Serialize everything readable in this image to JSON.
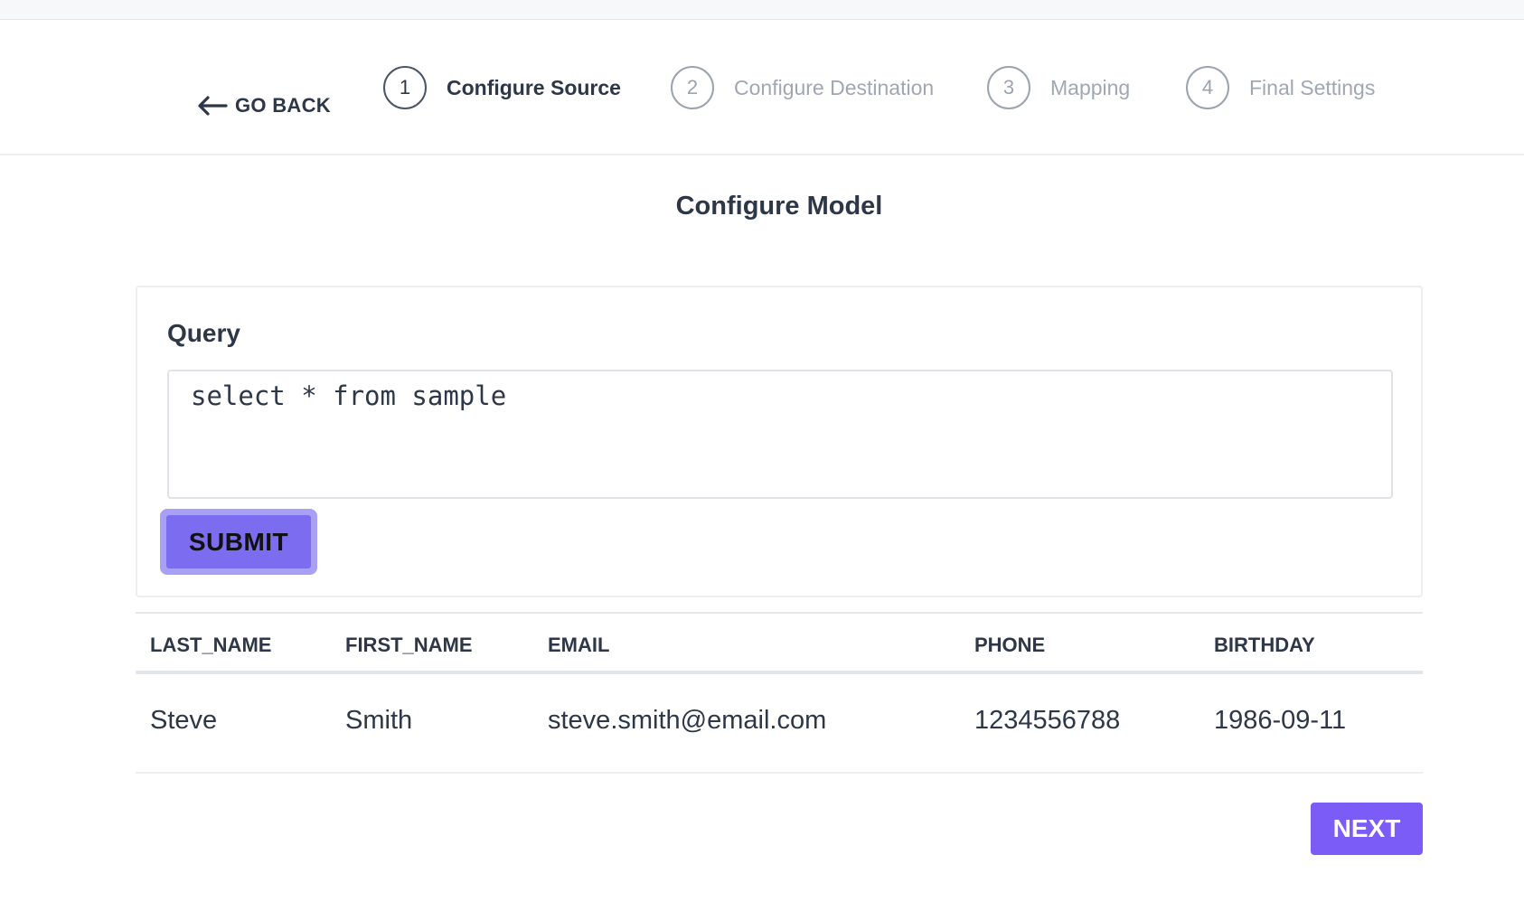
{
  "nav": {
    "back_label": "GO BACK",
    "steps": [
      {
        "number": "1",
        "label": "Configure Source",
        "active": true
      },
      {
        "number": "2",
        "label": "Configure Destination",
        "active": false
      },
      {
        "number": "3",
        "label": "Mapping",
        "active": false
      },
      {
        "number": "4",
        "label": "Final Settings",
        "active": false
      }
    ]
  },
  "page": {
    "title": "Configure Model"
  },
  "query": {
    "label": "Query",
    "value": "select * from sample",
    "submit_label": "SUBMIT"
  },
  "results": {
    "columns": [
      "LAST_NAME",
      "FIRST_NAME",
      "EMAIL",
      "PHONE",
      "BIRTHDAY"
    ],
    "rows": [
      [
        "Steve",
        "Smith",
        "steve.smith@email.com",
        "1234556788",
        "1986-09-11"
      ]
    ]
  },
  "footer": {
    "next_label": "NEXT"
  },
  "colors": {
    "accent": "#7c5cf7",
    "text": "#2d3748",
    "muted": "#a0a7b3"
  }
}
